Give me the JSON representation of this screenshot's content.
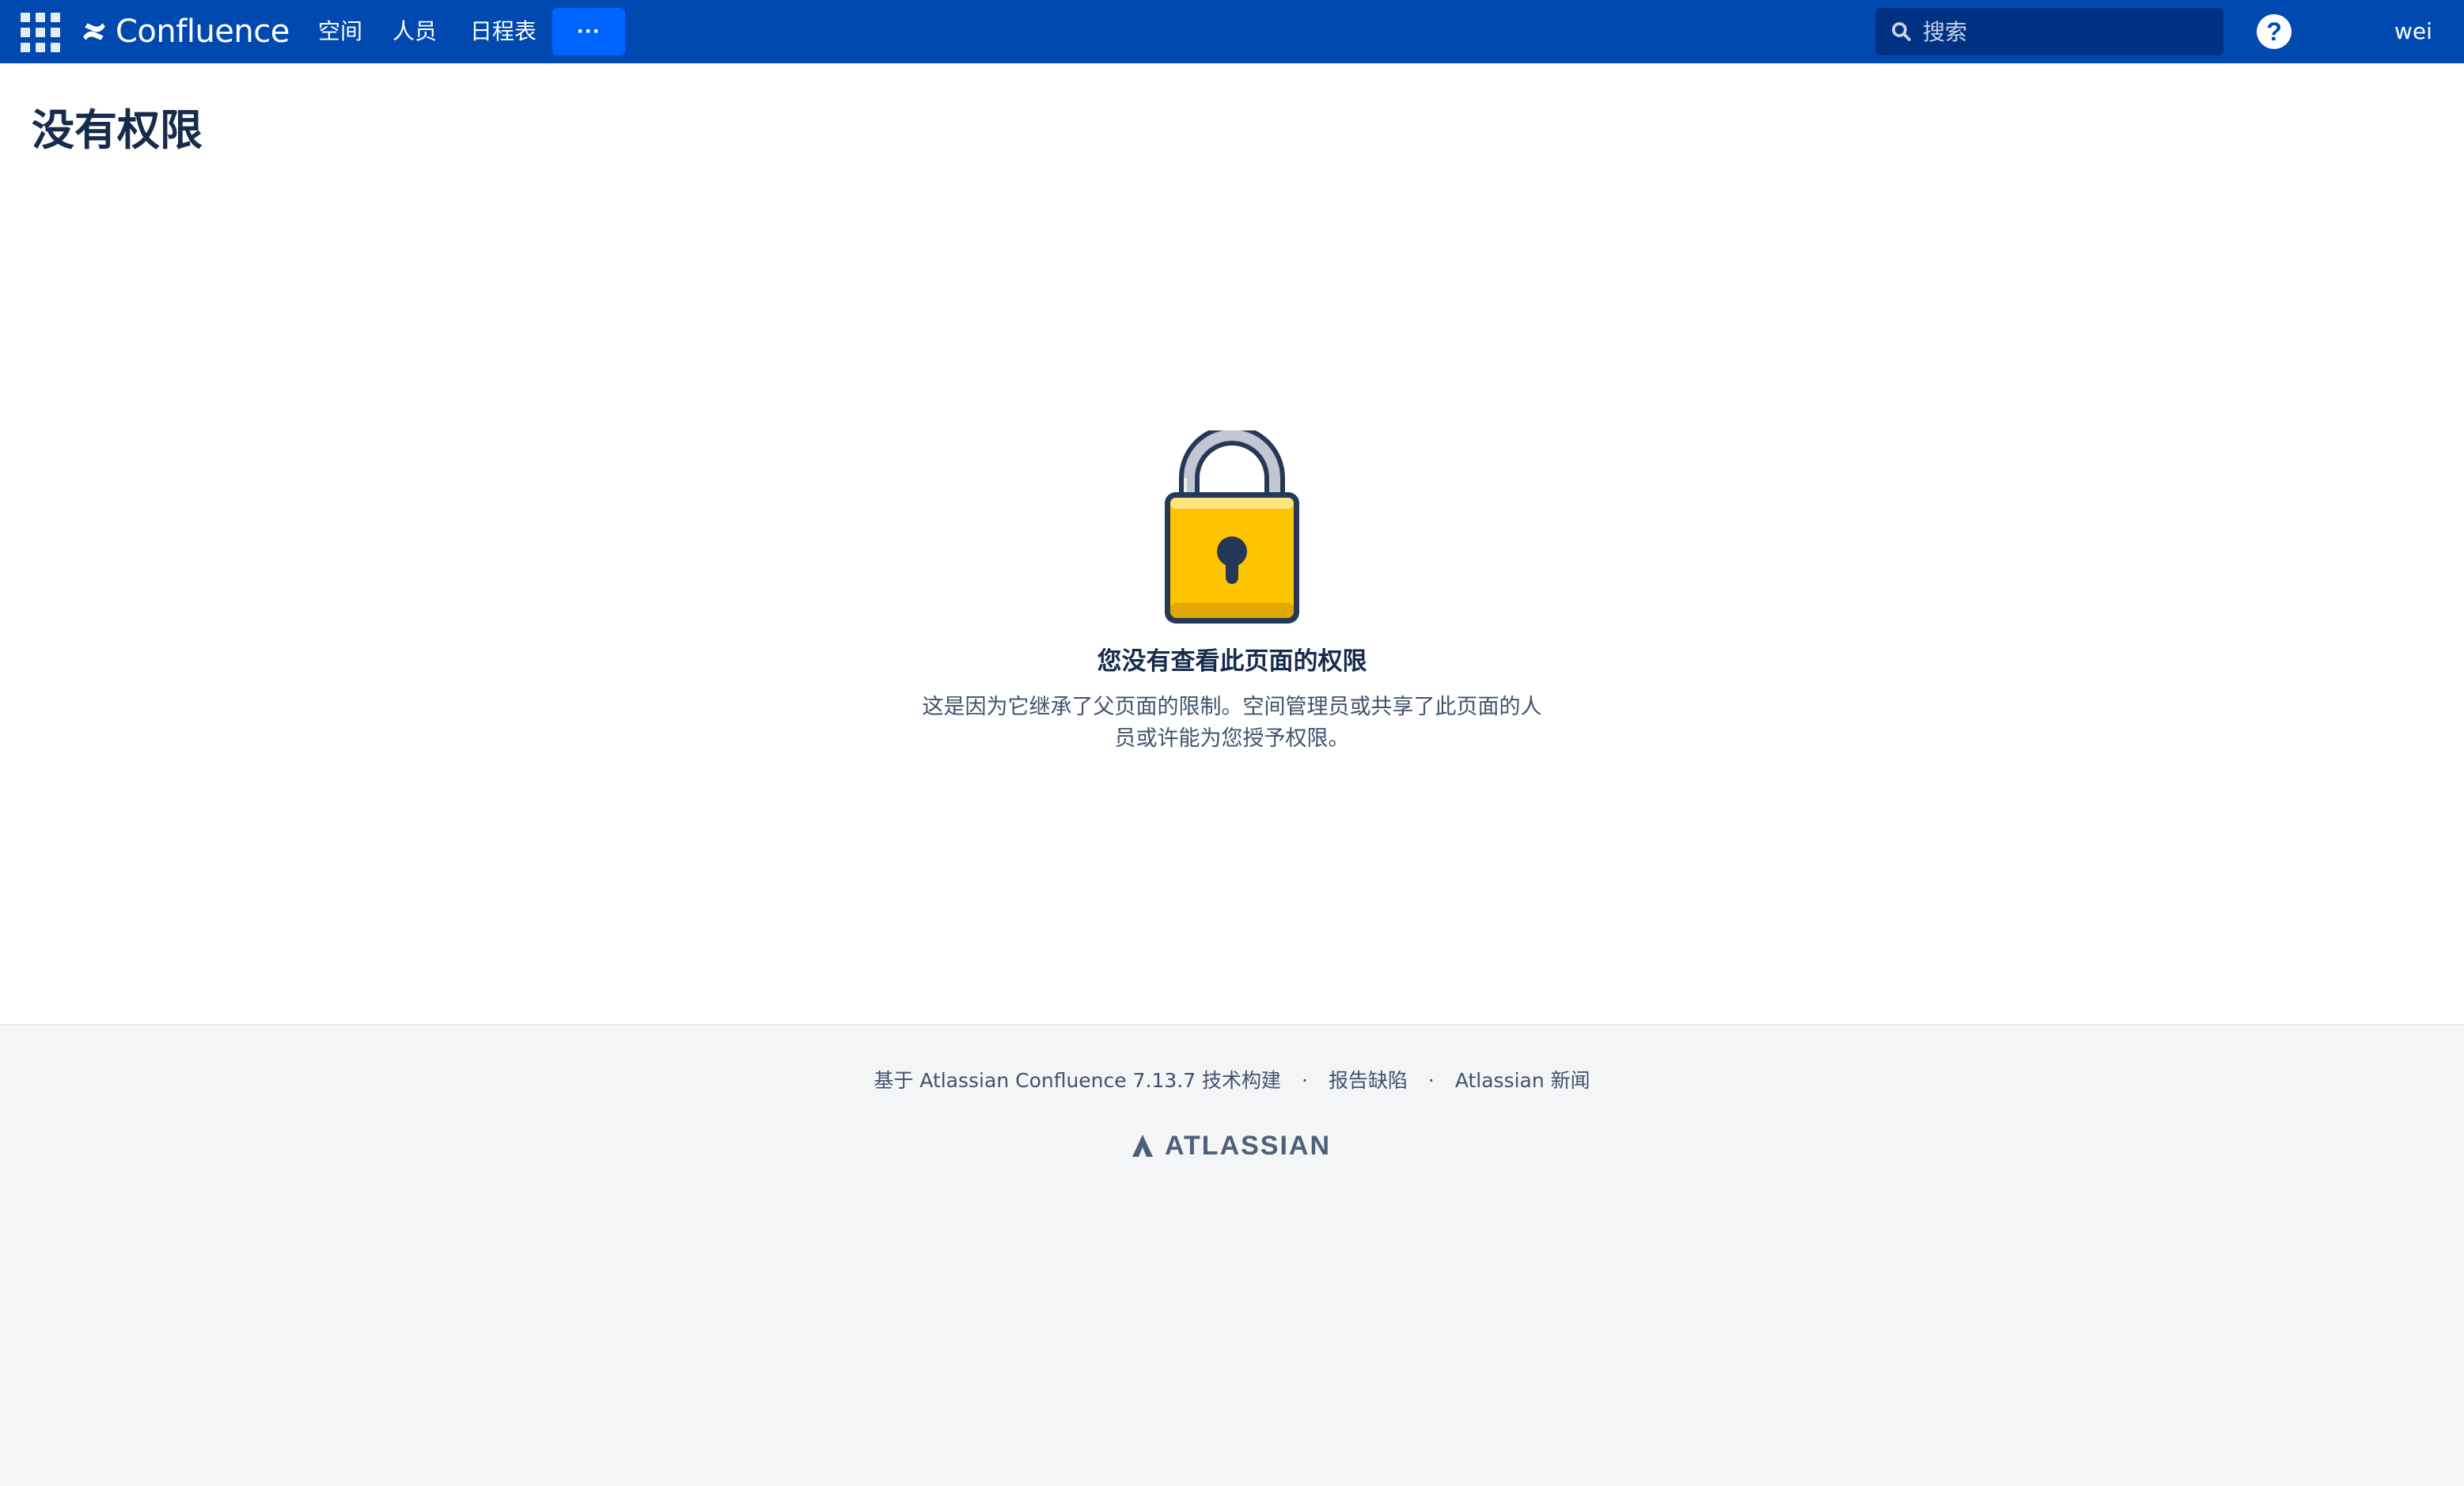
{
  "header": {
    "logo_text": "Confluence",
    "nav": [
      {
        "label": "空间"
      },
      {
        "label": "人员"
      },
      {
        "label": "日程表"
      }
    ],
    "more_label": "···",
    "search_placeholder": "搜索",
    "help_label": "?",
    "user_name": "wei"
  },
  "page": {
    "title": "没有权限",
    "message_title": "您没有查看此页面的权限",
    "message_body": "这是因为它继承了父页面的限制。空间管理员或共享了此页面的人员或许能为您授予权限。"
  },
  "footer": {
    "powered_by": "基于 Atlassian Confluence 7.13.7 技术构建",
    "report_bug": "报告缺陷",
    "news": "Atlassian 新闻",
    "separator": "·",
    "brand": "ATLASSIAN"
  },
  "colors": {
    "header_bg": "#0049b0",
    "more_button_bg": "#0065ff",
    "lock_body": "#ffc400",
    "lock_outline": "#253858",
    "footer_bg": "#f4f5f7"
  },
  "icons": [
    "app-switcher-icon",
    "confluence-logo-icon",
    "search-icon",
    "help-icon",
    "padlock-icon",
    "atlassian-logo-icon"
  ]
}
